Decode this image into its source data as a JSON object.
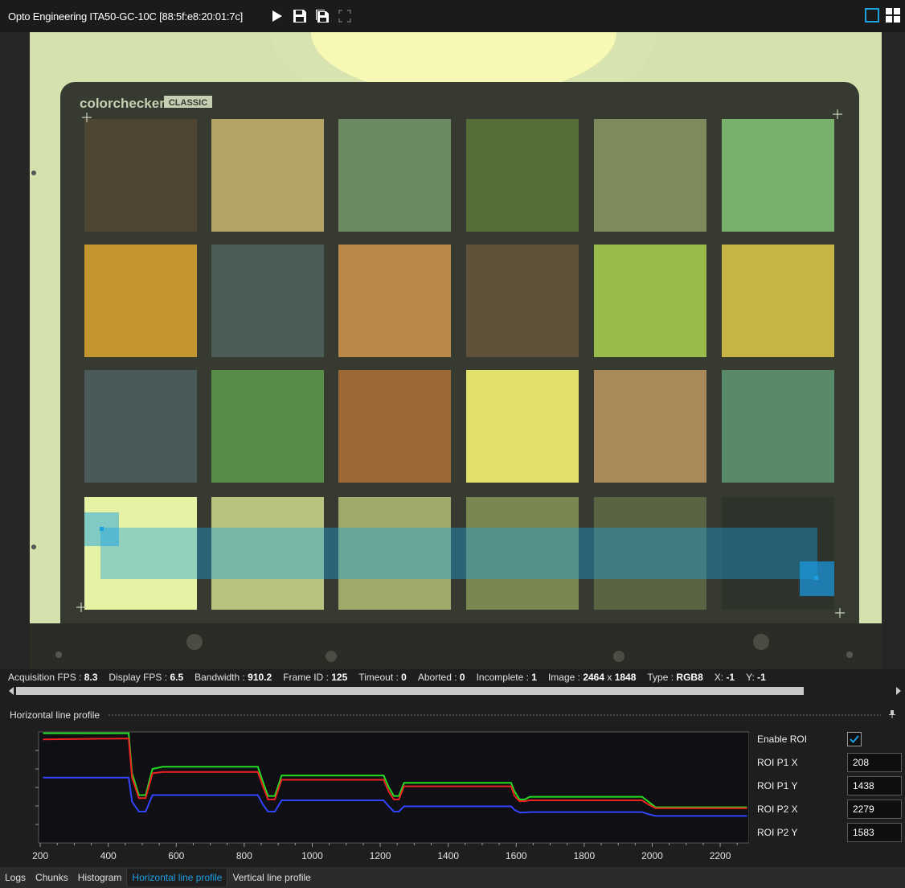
{
  "window": {
    "title": "Opto Engineering ITA50-GC-10C [88:5f:e8:20:01:7c]",
    "icons": [
      "play-icon",
      "save-icon",
      "save-all-icon",
      "fullscreen-icon",
      "single-view-icon",
      "grid-view-icon"
    ]
  },
  "image": {
    "brand": "colorchecker",
    "brand_badge": "CLASSIC",
    "patches": [
      [
        "#4e4632",
        "#b3a465",
        "#6b8a62",
        "#556e38",
        "#7f8a5c",
        "#77b06a"
      ],
      [
        "#c4962f",
        "#4c5d57",
        "#b98a47",
        "#5e5338",
        "#98bb4c",
        "#c6b444"
      ],
      [
        "#4a5a58",
        "#578d47",
        "#9b6935",
        "#e1e068",
        "#a9895a",
        "#588a6a"
      ],
      [
        "#e6f2a4",
        "#b6c47f",
        "#9daa6c",
        "#7b8750",
        "#5a6443",
        "#2e332b"
      ]
    ],
    "roi_color": "#1ba1e2"
  },
  "status": {
    "acq_fps_label": "Acquisition FPS : ",
    "acq_fps": "8.3",
    "disp_fps_label": "Display FPS : ",
    "disp_fps": "6.5",
    "bandwidth_label": "Bandwidth : ",
    "bandwidth": "910.2",
    "frame_id_label": "Frame ID : ",
    "frame_id": "125",
    "timeout_label": "Timeout : ",
    "timeout": "0",
    "aborted_label": "Aborted : ",
    "aborted": "0",
    "incomplete_label": "Incomplete : ",
    "incomplete": "1",
    "image_label": "Image : ",
    "image_w": "2464",
    "image_x": " x ",
    "image_h": "1848",
    "type_label": "Type : ",
    "type": "RGB8",
    "x_label": "X: ",
    "x": "-1",
    "y_label": "Y: ",
    "y": "-1"
  },
  "panel": {
    "title": "Horizontal line profile",
    "pin_icon": "pin-icon"
  },
  "roi_form": {
    "enable_label": "Enable ROI",
    "enable_checked": true,
    "p1x_label": "ROI P1 X",
    "p1x": "208",
    "p1y_label": "ROI P1 Y",
    "p1y": "1438",
    "p2x_label": "ROI P2 X",
    "p2x": "2279",
    "p2y_label": "ROI P2 Y",
    "p2y": "1583"
  },
  "tabs": [
    "Logs",
    "Chunks",
    "Histogram",
    "Horizontal line profile",
    "Vertical line profile"
  ],
  "active_tab": "Horizontal line profile",
  "chart_data": {
    "type": "line",
    "title": "",
    "xlabel": "",
    "ylabel": "",
    "xlim": [
      195,
      2285
    ],
    "ylim": [
      0,
      255
    ],
    "xticks": [
      200,
      400,
      600,
      800,
      1000,
      1200,
      1400,
      1600,
      1800,
      2000,
      2200
    ],
    "grid": false,
    "series": [
      {
        "color": "#22dd22",
        "x": [
          208,
          460,
          470,
          490,
          510,
          530,
          560,
          840,
          855,
          870,
          890,
          910,
          1210,
          1225,
          1240,
          1255,
          1270,
          1585,
          1595,
          1610,
          1625,
          1640,
          1970,
          1990,
          2010,
          2030,
          2279
        ],
        "y": [
          252,
          252,
          160,
          110,
          110,
          170,
          175,
          175,
          140,
          108,
          108,
          155,
          155,
          128,
          108,
          108,
          138,
          138,
          118,
          100,
          100,
          106,
          106,
          94,
          82,
          82,
          82
        ]
      },
      {
        "color": "#ee2222",
        "x": [
          208,
          460,
          470,
          490,
          510,
          530,
          560,
          840,
          855,
          870,
          890,
          910,
          1210,
          1225,
          1240,
          1255,
          1270,
          1585,
          1595,
          1610,
          1625,
          1640,
          1970,
          1990,
          2010,
          2030,
          2279
        ],
        "y": [
          238,
          240,
          150,
          103,
          103,
          160,
          163,
          163,
          130,
          100,
          100,
          145,
          145,
          118,
          100,
          100,
          130,
          130,
          108,
          96,
          96,
          98,
          98,
          88,
          80,
          80,
          80
        ]
      },
      {
        "color": "#3344ff",
        "x": [
          208,
          460,
          470,
          490,
          510,
          530,
          560,
          840,
          855,
          870,
          890,
          910,
          1210,
          1225,
          1240,
          1255,
          1270,
          1585,
          1595,
          1610,
          1625,
          1640,
          1970,
          1990,
          2010,
          2030,
          2279
        ],
        "y": [
          150,
          150,
          95,
          72,
          72,
          110,
          110,
          110,
          88,
          72,
          72,
          98,
          98,
          84,
          72,
          72,
          84,
          84,
          76,
          70,
          70,
          71,
          71,
          66,
          62,
          62,
          62
        ]
      }
    ]
  }
}
